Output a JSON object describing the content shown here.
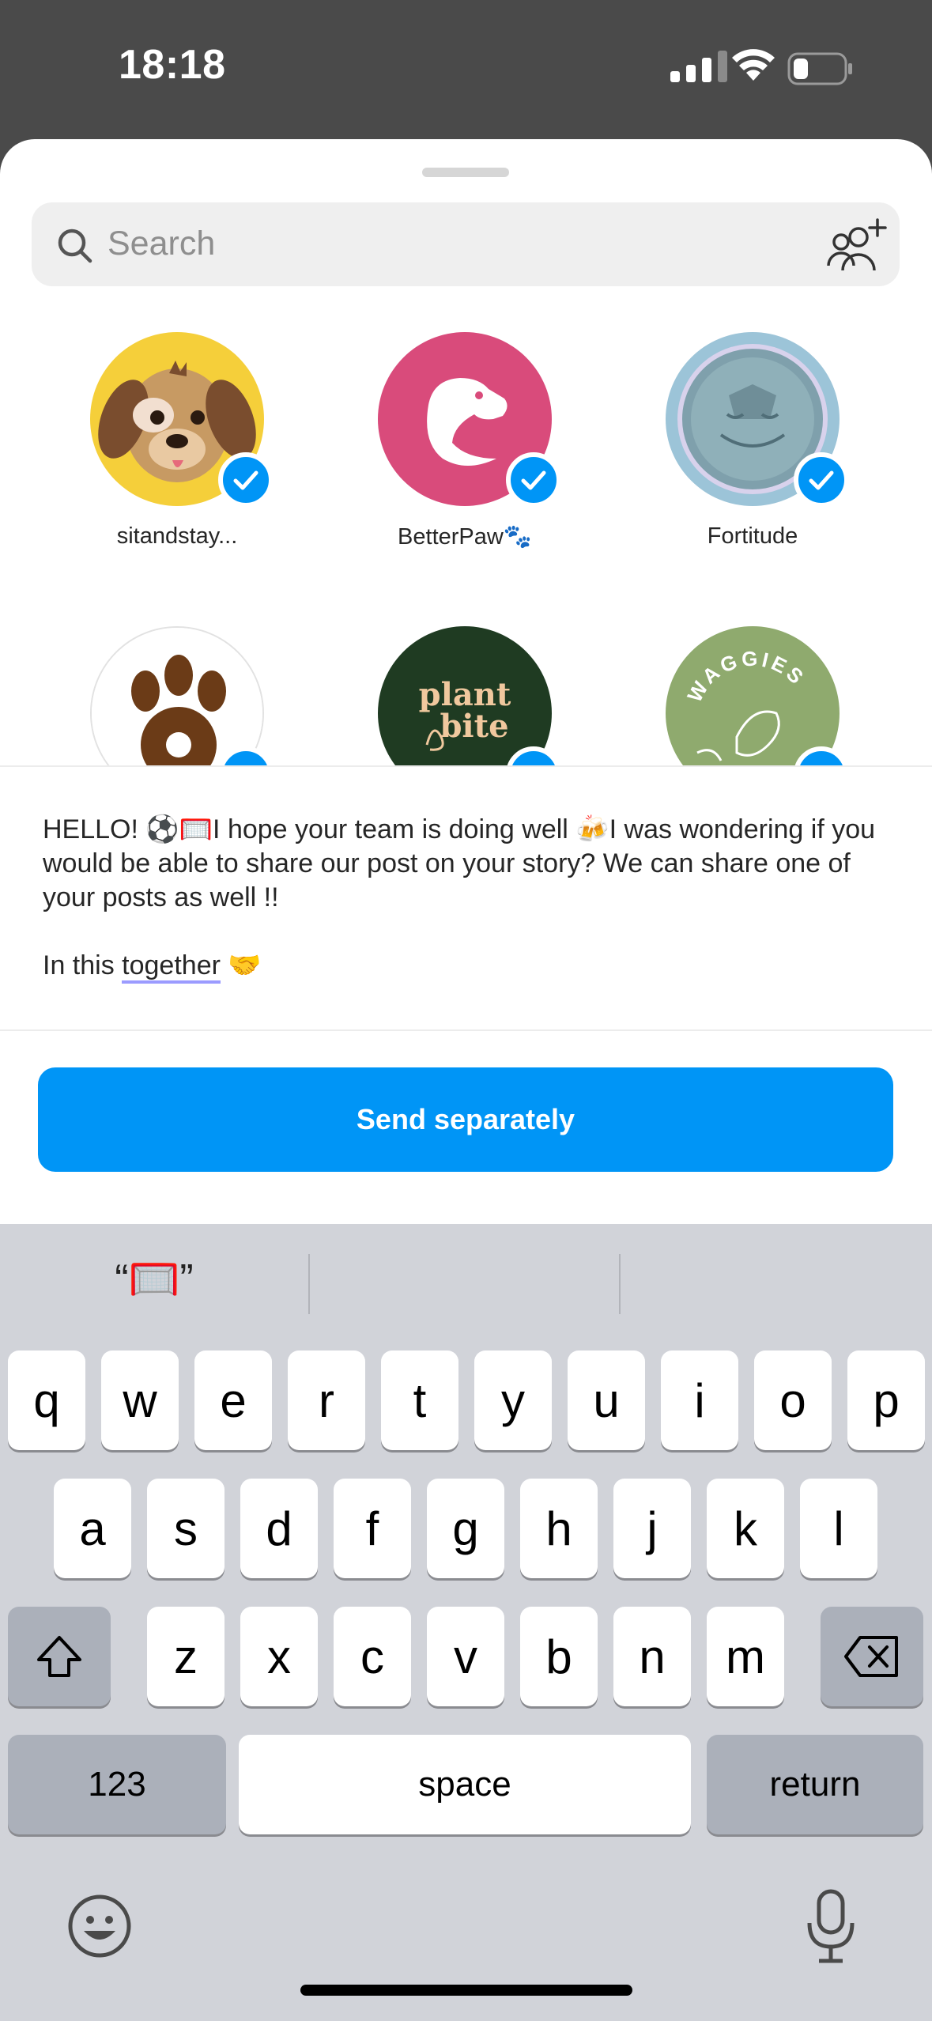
{
  "status_bar": {
    "time": "18:18",
    "battery_level": 0.3
  },
  "search": {
    "placeholder": "Search"
  },
  "contacts": [
    {
      "name": "sitandstay...",
      "selected": true
    },
    {
      "name": "BetterPaw🐾",
      "selected": true
    },
    {
      "name": "Fortitude",
      "selected": true
    },
    {
      "name": "",
      "logo_text": "",
      "selected": true
    },
    {
      "name": "",
      "logo_text": "plant bite",
      "logo_line1": "plant",
      "logo_line2": "bite",
      "selected": true
    },
    {
      "name": "",
      "logo_text": "WAGGIES",
      "selected": true
    }
  ],
  "message": {
    "line1": "HELLO! ⚽🥅I hope your team is doing well 🍻I was wondering if you would be able to share our post on your story? We can share one of your posts as well !!",
    "line2_prefix": "In this ",
    "line2_underlined": "together",
    "line2_suffix": " 🤝"
  },
  "send_button": {
    "label": "Send separately"
  },
  "keyboard": {
    "suggestions": [
      "“🥅”",
      "",
      ""
    ],
    "row1": [
      "q",
      "w",
      "e",
      "r",
      "t",
      "y",
      "u",
      "i",
      "o",
      "p"
    ],
    "row2": [
      "a",
      "s",
      "d",
      "f",
      "g",
      "h",
      "j",
      "k",
      "l"
    ],
    "row3": [
      "z",
      "x",
      "c",
      "v",
      "b",
      "n",
      "m"
    ],
    "numbers_label": "123",
    "space_label": "space",
    "return_label": "return"
  },
  "colors": {
    "accent": "#0095f6",
    "keyboard_bg": "#d1d3d9"
  }
}
